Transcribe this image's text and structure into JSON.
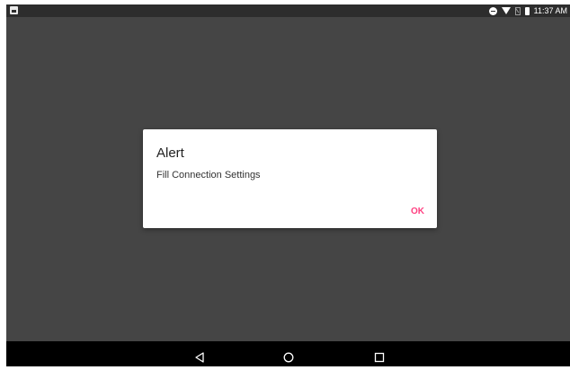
{
  "status_bar": {
    "time": "11:37 AM",
    "icons": [
      "gallery-icon",
      "do-not-disturb-icon",
      "wifi-icon",
      "no-signal-icon",
      "battery-icon"
    ]
  },
  "dialog": {
    "title": "Alert",
    "message": "Fill Connection Settings",
    "ok_label": "OK",
    "accent_color": "#ff4081"
  },
  "navigation": {
    "buttons": [
      "back-icon",
      "home-icon",
      "recent-apps-icon"
    ]
  },
  "colors": {
    "screen_background": "#454545",
    "status_bar": "#2d2d2d",
    "nav_bar": "#000000",
    "dialog_background": "#ffffff"
  }
}
